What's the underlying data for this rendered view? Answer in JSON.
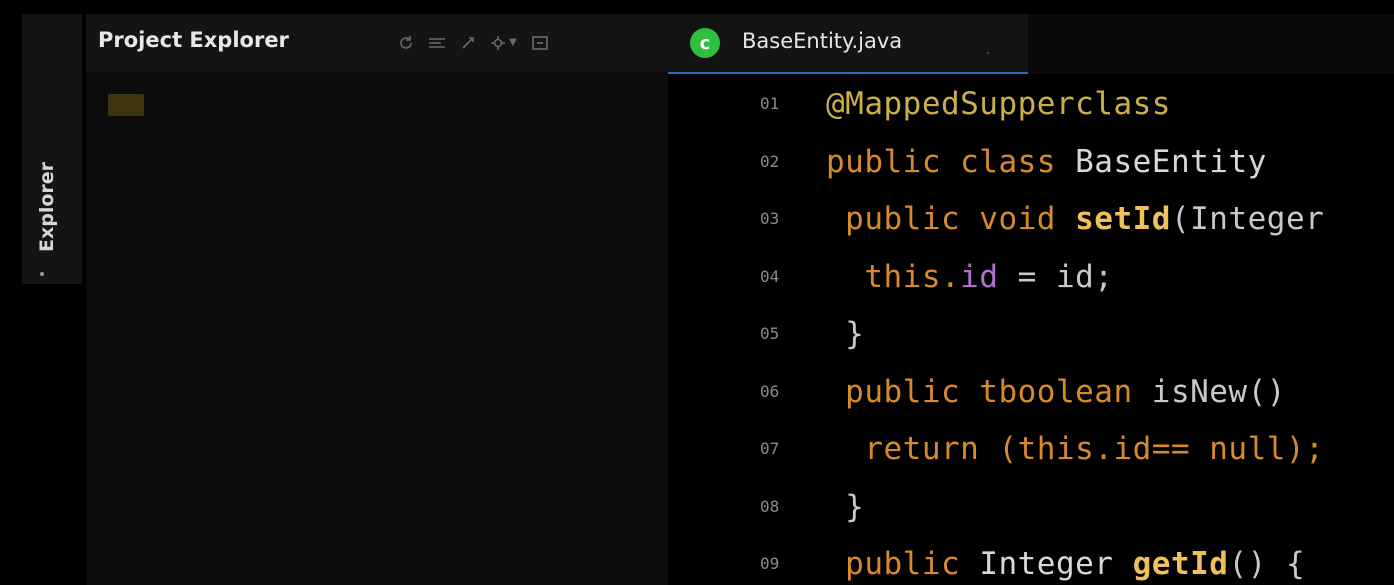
{
  "activity_bar": {
    "explorer_label": "Explorer"
  },
  "project_explorer": {
    "title": "Project Explorer",
    "toolbar": [
      {
        "name": "sync-icon",
        "glyph": "↻"
      },
      {
        "name": "collapse-all-icon",
        "glyph": "⇆"
      },
      {
        "name": "link-with-editor-icon",
        "glyph": "⤢"
      },
      {
        "name": "view-menu-icon",
        "glyph": "⚙"
      },
      {
        "name": "maximize-icon",
        "glyph": "▢"
      }
    ]
  },
  "editor": {
    "tab": {
      "label": "BaseEntity.java",
      "icon_letter": "c",
      "close": "."
    },
    "lines": [
      {
        "num": "01",
        "tokens": [
          {
            "t": "@MappedSupperclass",
            "c": "anno"
          }
        ]
      },
      {
        "num": "02",
        "tokens": [
          {
            "t": "public class ",
            "c": "kw"
          },
          {
            "t": "BaseEntity",
            "c": "ty"
          }
        ]
      },
      {
        "num": "03",
        "tokens": [
          {
            "t": " public void ",
            "c": "kw"
          },
          {
            "t": "setId",
            "c": "fn"
          },
          {
            "t": "(Integer",
            "c": "pl"
          }
        ]
      },
      {
        "num": "04",
        "tokens": [
          {
            "t": "  this.",
            "c": "kw"
          },
          {
            "t": "id",
            "c": "fd"
          },
          {
            "t": " = id;",
            "c": "pl"
          }
        ]
      },
      {
        "num": "05",
        "tokens": [
          {
            "t": " }",
            "c": "pl"
          }
        ]
      },
      {
        "num": "06",
        "tokens": [
          {
            "t": " public tboolean ",
            "c": "kw"
          },
          {
            "t": "isNew() ",
            "c": "pl"
          }
        ]
      },
      {
        "num": "07",
        "tokens": [
          {
            "t": "  return (this.id== null);",
            "c": "kw"
          }
        ]
      },
      {
        "num": "08",
        "tokens": [
          {
            "t": " }",
            "c": "pl"
          }
        ]
      },
      {
        "num": "09",
        "tokens": [
          {
            "t": " public ",
            "c": "kw"
          },
          {
            "t": "Integer ",
            "c": "ty"
          },
          {
            "t": "getId",
            "c": "fn"
          },
          {
            "t": "() {",
            "c": "pl"
          }
        ]
      }
    ]
  },
  "colors": {
    "accent_tab_underline": "#2f6db5",
    "java_icon": "#2fbf3e",
    "keyword": "#d68a2c",
    "annotation": "#cbb04a",
    "method": "#f0c05a",
    "field": "#b073c9"
  }
}
